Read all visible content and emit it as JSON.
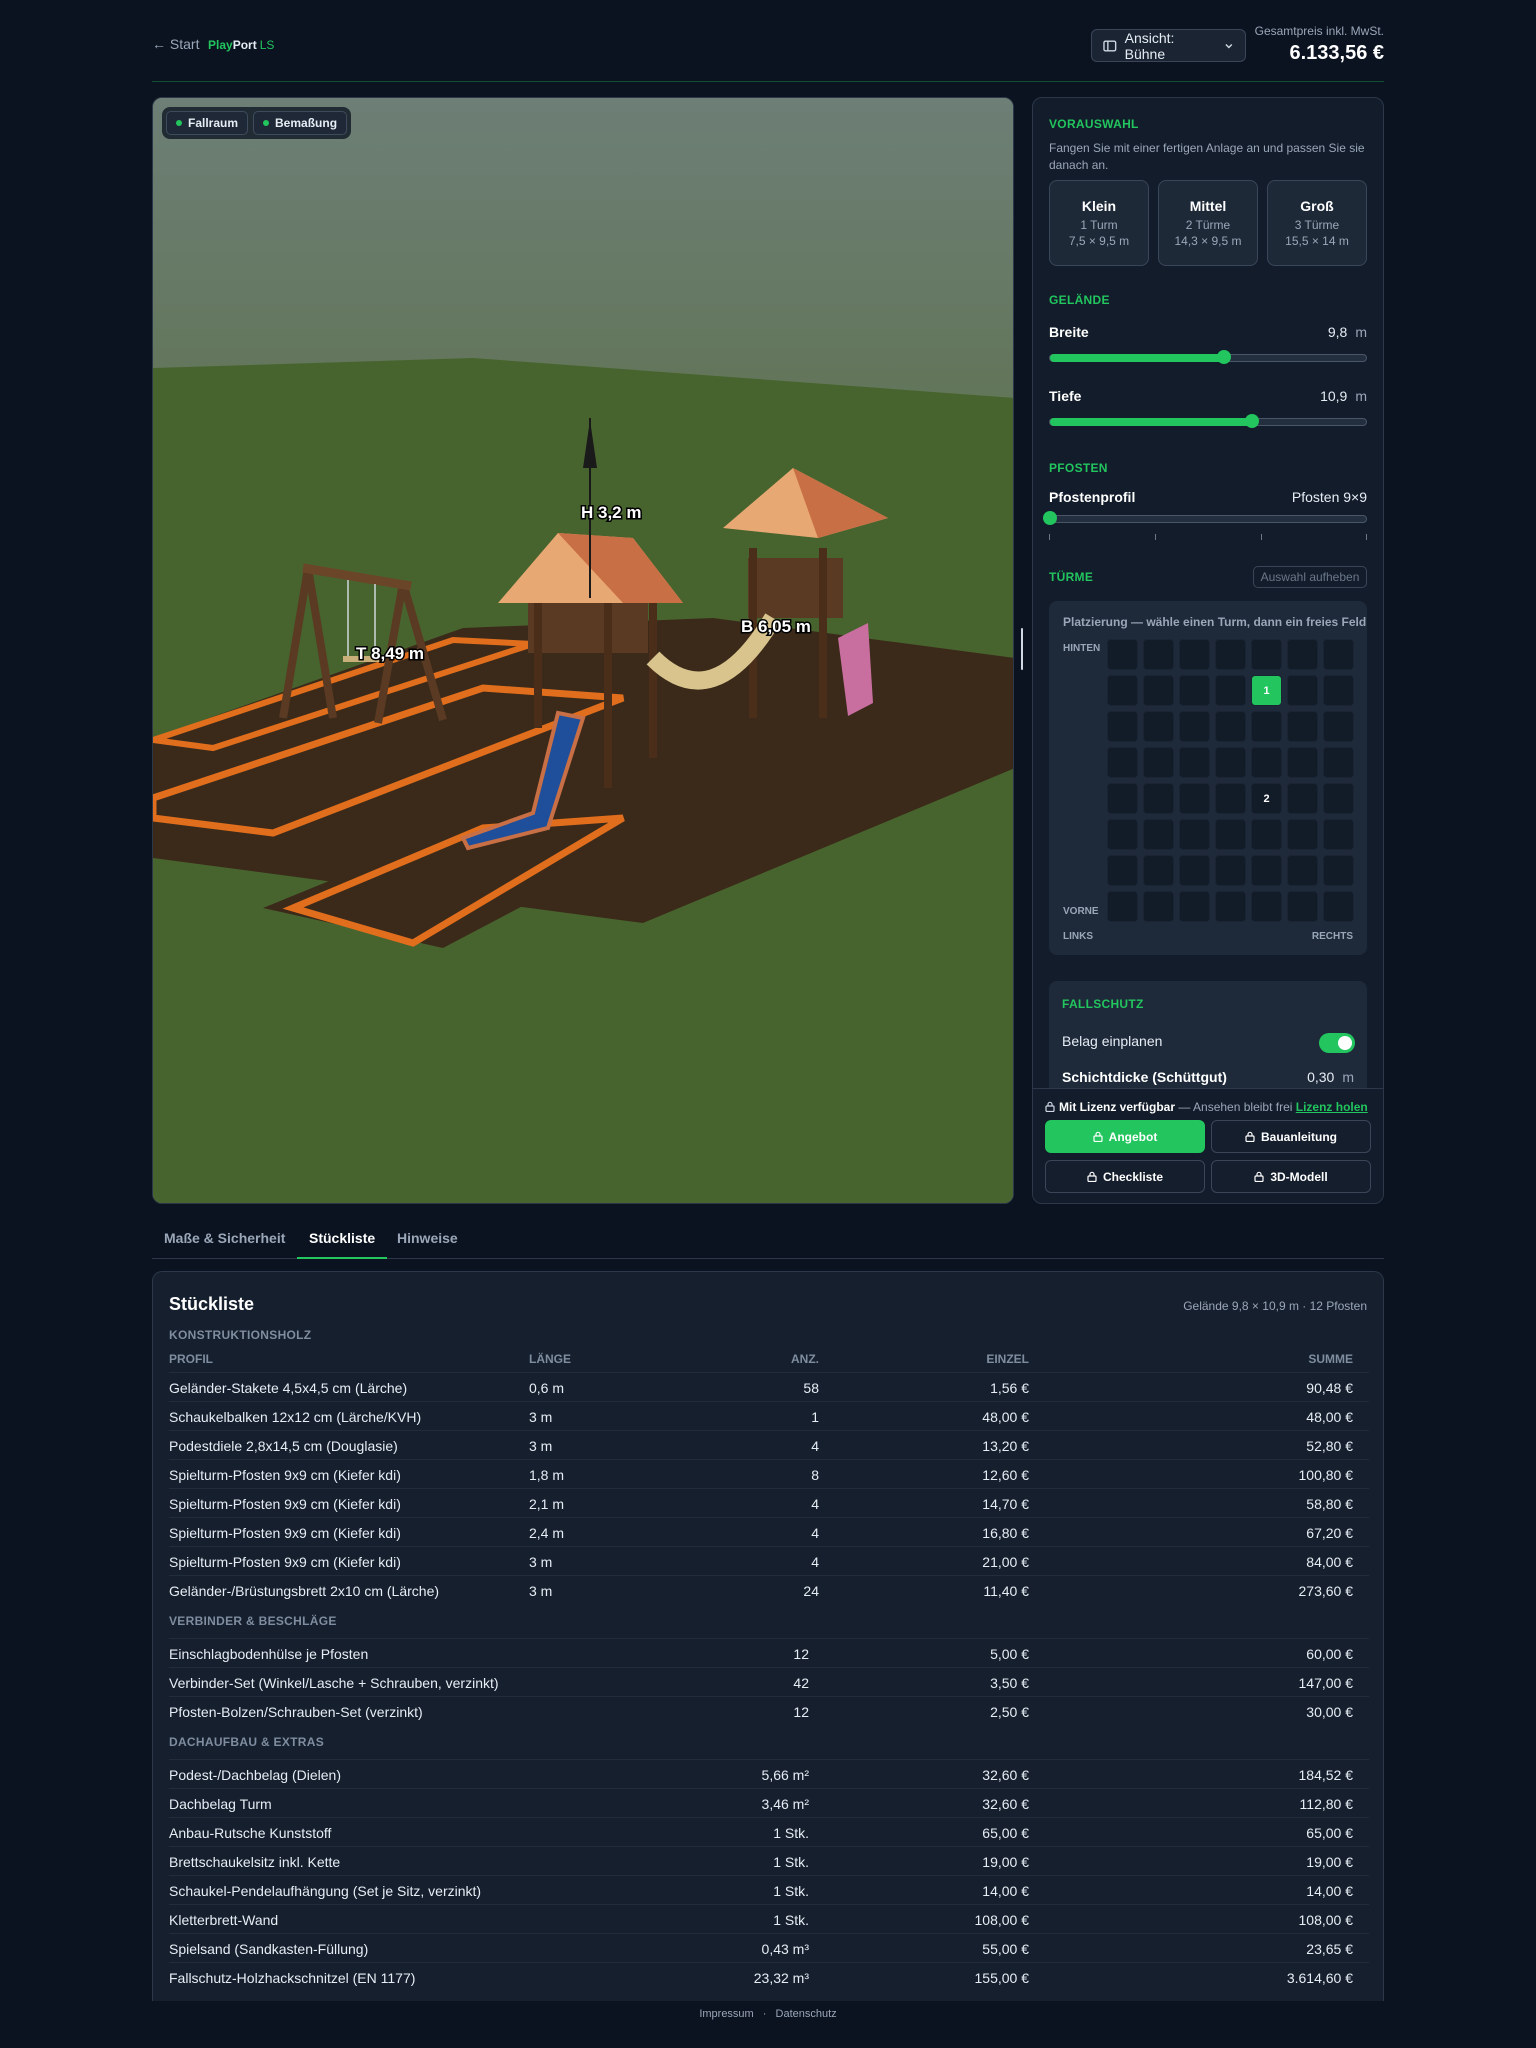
{
  "header": {
    "back_label": "← Start",
    "logo": {
      "play": "Play",
      "port": "Port",
      "ls": "LS"
    },
    "view_select": "Ansicht: Bühne",
    "price_label": "Gesamtpreis inkl. MwSt.",
    "price": "6.133,56 €"
  },
  "viewport": {
    "chips": [
      "Fallraum",
      "Bemaßung"
    ],
    "dimensions": {
      "height": "H 3,2 m",
      "depth": "T 8,49 m",
      "width": "B 6,05 m"
    }
  },
  "sidebar": {
    "vorauswahl": {
      "title": "VORAUSWAHL",
      "desc": "Fangen Sie mit einer fertigen Anlage an und passen Sie sie danach an.",
      "presets": [
        {
          "name": "Klein",
          "towers": "1 Turm",
          "size": "7,5 × 9,5 m"
        },
        {
          "name": "Mittel",
          "towers": "2 Türme",
          "size": "14,3 × 9,5 m"
        },
        {
          "name": "Groß",
          "towers": "3 Türme",
          "size": "15,5 × 14 m"
        }
      ]
    },
    "gelaende": {
      "title": "GELÄNDE",
      "width_label": "Breite",
      "width_value": "9,8",
      "width_unit": "m",
      "width_fraction": 0.55,
      "depth_label": "Tiefe",
      "depth_value": "10,9",
      "depth_unit": "m",
      "depth_fraction": 0.64
    },
    "pfosten": {
      "title": "PFOSTEN",
      "profile_label": "Pfostenprofil",
      "profile_value": "Pfosten 9×9",
      "profile_fraction": 0.0
    },
    "tuerme": {
      "title": "TÜRME",
      "deselect_label": "Auswahl aufheben",
      "grid_title": "Platzierung — wähle einen Turm, dann ein freies Feld",
      "label_back": "HINTEN",
      "label_front": "VORNE",
      "label_left": "LINKS",
      "label_right": "RECHTS",
      "rows": 8,
      "cols": 7,
      "towers": [
        {
          "label": "1",
          "row": 1,
          "col": 4,
          "selected": true
        },
        {
          "label": "2",
          "row": 4,
          "col": 4,
          "selected": false
        }
      ]
    },
    "fallschutz": {
      "title": "FALLSCHUTZ",
      "toggle_label": "Belag einplanen",
      "toggle_on": true,
      "thickness_label": "Schichtdicke (Schüttgut)",
      "thickness_value": "0,30",
      "thickness_unit": "m"
    },
    "license": {
      "strong": "Mit Lizenz verfügbar",
      "text": " — Ansehen bleibt frei ",
      "link": "Lizenz holen"
    },
    "actions": {
      "offer": "Angebot",
      "manual": "Bauanleitung",
      "checklist": "Checkliste",
      "model": "3D-Modell"
    }
  },
  "tabs": [
    "Maße & Sicherheit",
    "Stückliste",
    "Hinweise"
  ],
  "table": {
    "title": "Stückliste",
    "meta": "Gelände 9,8 × 10,9 m · 12 Pfosten",
    "headers": {
      "profile": "PROFIL",
      "length": "LÄNGE",
      "qty": "ANZ.",
      "unit": "EINZEL",
      "sum": "SUMME"
    },
    "groups": [
      {
        "name": "KONSTRUKTIONSHOLZ",
        "rows": [
          [
            "Geländer-Stakete 4,5x4,5 cm (Lärche)",
            "0,6 m",
            "58",
            "1,56 €",
            "90,48 €"
          ],
          [
            "Schaukelbalken 12x12 cm (Lärche/KVH)",
            "3 m",
            "1",
            "48,00 €",
            "48,00 €"
          ],
          [
            "Podestdiele 2,8x14,5 cm (Douglasie)",
            "3 m",
            "4",
            "13,20 €",
            "52,80 €"
          ],
          [
            "Spielturm-Pfosten 9x9 cm (Kiefer kdi)",
            "1,8 m",
            "8",
            "12,60 €",
            "100,80 €"
          ],
          [
            "Spielturm-Pfosten 9x9 cm (Kiefer kdi)",
            "2,1 m",
            "4",
            "14,70 €",
            "58,80 €"
          ],
          [
            "Spielturm-Pfosten 9x9 cm (Kiefer kdi)",
            "2,4 m",
            "4",
            "16,80 €",
            "67,20 €"
          ],
          [
            "Spielturm-Pfosten 9x9 cm (Kiefer kdi)",
            "3 m",
            "4",
            "21,00 €",
            "84,00 €"
          ],
          [
            "Geländer-/Brüstungsbrett 2x10 cm (Lärche)",
            "3 m",
            "24",
            "11,40 €",
            "273,60 €"
          ]
        ]
      },
      {
        "name": "VERBINDER & BESCHLÄGE",
        "rows": [
          [
            "Einschlagbodenhülse je Pfosten",
            "",
            "12",
            "5,00 €",
            "60,00 €"
          ],
          [
            "Verbinder-Set (Winkel/Lasche + Schrauben, verzinkt)",
            "",
            "42",
            "3,50 €",
            "147,00 €"
          ],
          [
            "Pfosten-Bolzen/Schrauben-Set (verzinkt)",
            "",
            "12",
            "2,50 €",
            "30,00 €"
          ]
        ]
      },
      {
        "name": "DACHAUFBAU & EXTRAS",
        "rows": [
          [
            "Podest-/Dachbelag (Dielen)",
            "",
            "5,66 m²",
            "32,60 €",
            "184,52 €"
          ],
          [
            "Dachbelag Turm",
            "",
            "3,46 m²",
            "32,60 €",
            "112,80 €"
          ],
          [
            "Anbau-Rutsche Kunststoff",
            "",
            "1 Stk.",
            "65,00 €",
            "65,00 €"
          ],
          [
            "Brettschaukelsitz inkl. Kette",
            "",
            "1 Stk.",
            "19,00 €",
            "19,00 €"
          ],
          [
            "Schaukel-Pendelaufhängung (Set je Sitz, verzinkt)",
            "",
            "1 Stk.",
            "14,00 €",
            "14,00 €"
          ],
          [
            "Kletterbrett-Wand",
            "",
            "1 Stk.",
            "108,00 €",
            "108,00 €"
          ],
          [
            "Spielsand (Sandkasten-Füllung)",
            "",
            "0,43 m³",
            "55,00 €",
            "23,65 €"
          ],
          [
            "Fallschutz-Holzhackschnitzel (EN 1177)",
            "",
            "23,32 m³",
            "155,00 €",
            "3.614,60 €"
          ]
        ]
      }
    ]
  },
  "footer": {
    "impressum": "Impressum",
    "sep": "·",
    "datenschutz": "Datenschutz"
  },
  "colors": {
    "accent": "#22c55e",
    "background": "#0b1320",
    "panel": "#151f2d"
  }
}
